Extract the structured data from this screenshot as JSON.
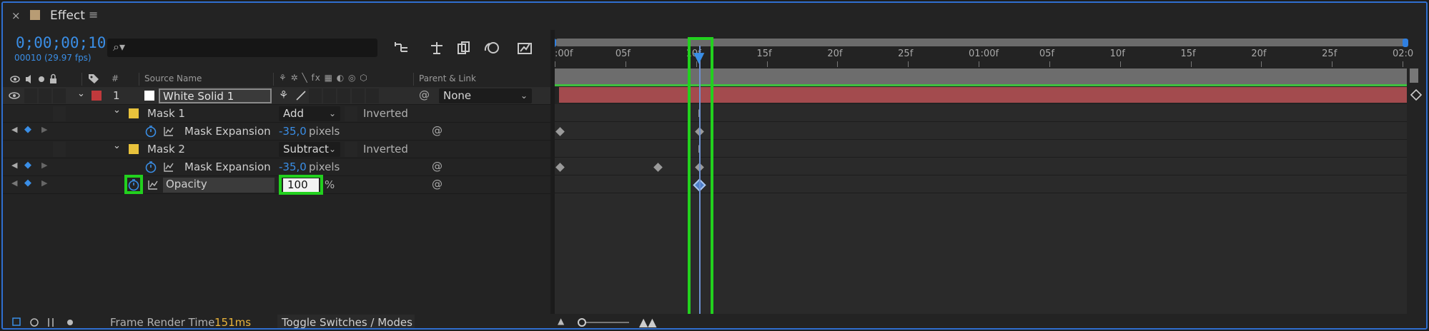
{
  "tab": {
    "close": "×",
    "title": "Effect",
    "menu": "≡",
    "swatch_color": "#b89c74"
  },
  "timecode": {
    "value": "0;00;00;10",
    "fps": "00010 (29.97 fps)"
  },
  "search": {
    "glyph": "⌕▾"
  },
  "ruler": {
    "labels": [
      ":00f",
      "05f",
      "10f",
      "15f",
      "20f",
      "25f",
      "01:00f",
      "05f",
      "10f",
      "15f",
      "20f",
      "25f",
      "02:0"
    ]
  },
  "columns": {
    "number": "#",
    "source_name": "Source Name",
    "parent_link": "Parent & Link",
    "switch_icons": "⚘ ✲ ╲ fx ▦ ◐ ◎ ⬡"
  },
  "layer": {
    "number": "1",
    "name": "White Solid 1",
    "parent": "None",
    "label_color": "#c0393c"
  },
  "mask1": {
    "name": "Mask 1",
    "mode": "Add",
    "inverted": "Inverted",
    "prop": "Mask Expansion",
    "value": "-35,0",
    "unit": "pixels"
  },
  "mask2": {
    "name": "Mask 2",
    "mode": "Subtract",
    "inverted": "Inverted",
    "prop": "Mask Expansion",
    "value": "-35,0",
    "unit": "pixels"
  },
  "opacity": {
    "name": "Opacity",
    "value": "100",
    "unit": "%"
  },
  "footer": {
    "frame_render_label": "Frame Render Time",
    "frame_render_value": "151ms",
    "toggle": "Toggle Switches / Modes"
  },
  "colors": {
    "accent": "#3a8ee6",
    "highlight": "#22d11e",
    "layer_bar": "#a34b4e"
  }
}
